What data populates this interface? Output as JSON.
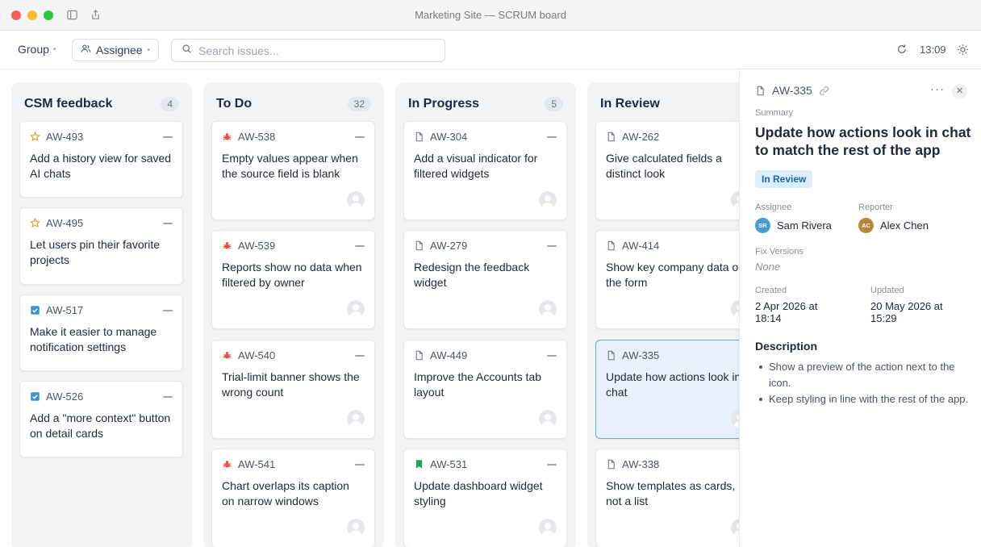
{
  "window": {
    "title": "Marketing Site — SCRUM board"
  },
  "toolbar": {
    "group_label": "Group",
    "assignee_label": "Assignee",
    "search_placeholder": "Search issues...",
    "time": "13:09"
  },
  "columns": [
    {
      "title": "CSM feedback",
      "count": "4",
      "cards": [
        {
          "key": "AW-493",
          "icon": "star-icon",
          "title": "Add a history view for saved AI chats"
        },
        {
          "key": "AW-495",
          "icon": "star-icon",
          "title": "Let users pin their favorite projects"
        },
        {
          "key": "AW-517",
          "icon": "checkbox-icon",
          "title": "Make it easier to manage notification settings"
        },
        {
          "key": "AW-526",
          "icon": "checkbox-icon",
          "title": "Add a \"more context\" button on detail cards"
        }
      ]
    },
    {
      "title": "To Do",
      "count": "32",
      "cards": [
        {
          "key": "AW-538",
          "icon": "bug-icon",
          "title": "Empty values appear when the source field is blank"
        },
        {
          "key": "AW-539",
          "icon": "bug-icon",
          "title": "Reports show no data when filtered by owner"
        },
        {
          "key": "AW-540",
          "icon": "bug-icon",
          "title": "Trial-limit banner shows the wrong count"
        },
        {
          "key": "AW-541",
          "icon": "bug-icon",
          "title": "Chart overlaps its caption on narrow windows"
        }
      ]
    },
    {
      "title": "In Progress",
      "count": "5",
      "cards": [
        {
          "key": "AW-304",
          "icon": "document-icon",
          "title": "Add a visual indicator for filtered widgets"
        },
        {
          "key": "AW-279",
          "icon": "document-icon",
          "title": "Redesign the feedback widget"
        },
        {
          "key": "AW-449",
          "icon": "document-icon",
          "title": "Improve the Accounts tab layout"
        },
        {
          "key": "AW-531",
          "icon": "bookmark-icon",
          "title": "Update dashboard widget styling"
        }
      ]
    },
    {
      "title": "In Review",
      "count": "",
      "cards": [
        {
          "key": "AW-262",
          "icon": "document-icon",
          "title": "Give calculated fields a distinct look"
        },
        {
          "key": "AW-414",
          "icon": "document-icon",
          "title": "Show key company data on the form"
        },
        {
          "key": "AW-335",
          "icon": "document-icon",
          "title": "Update how actions look in chat"
        },
        {
          "key": "AW-338",
          "icon": "document-icon",
          "title": "Show templates as cards, not a list"
        }
      ]
    }
  ],
  "detail": {
    "key": "AW-335",
    "summary_label": "Summary",
    "title": "Update how actions look in chat to match the rest of the app",
    "status": "In Review",
    "assignee_label": "Assignee",
    "assignee_name": "Sam Rivera",
    "assignee_initials": "SR",
    "reporter_label": "Reporter",
    "reporter_name": "Alex Chen",
    "reporter_initials": "AC",
    "fix_versions_label": "Fix Versions",
    "fix_versions_value": "None",
    "created_label": "Created",
    "created_line1": "2 Apr 2026 at",
    "created_line2": "18:14",
    "updated_label": "Updated",
    "updated_line1": "20 May 2026 at",
    "updated_line2": "15:29",
    "description_label": "Description",
    "description": [
      "Show a preview of the action next to the icon.",
      "Keep styling in line with the rest of the app."
    ]
  },
  "colors": {
    "status_bg": "#ddeefe",
    "status_text": "#1f63b0",
    "assignee_avatar": "#4a9bd6",
    "reporter_avatar": "#b8863b",
    "bug": "#e5533d",
    "star": "#e0a030",
    "checkbox": "#3d8fd6",
    "bookmark": "#22a05a"
  }
}
